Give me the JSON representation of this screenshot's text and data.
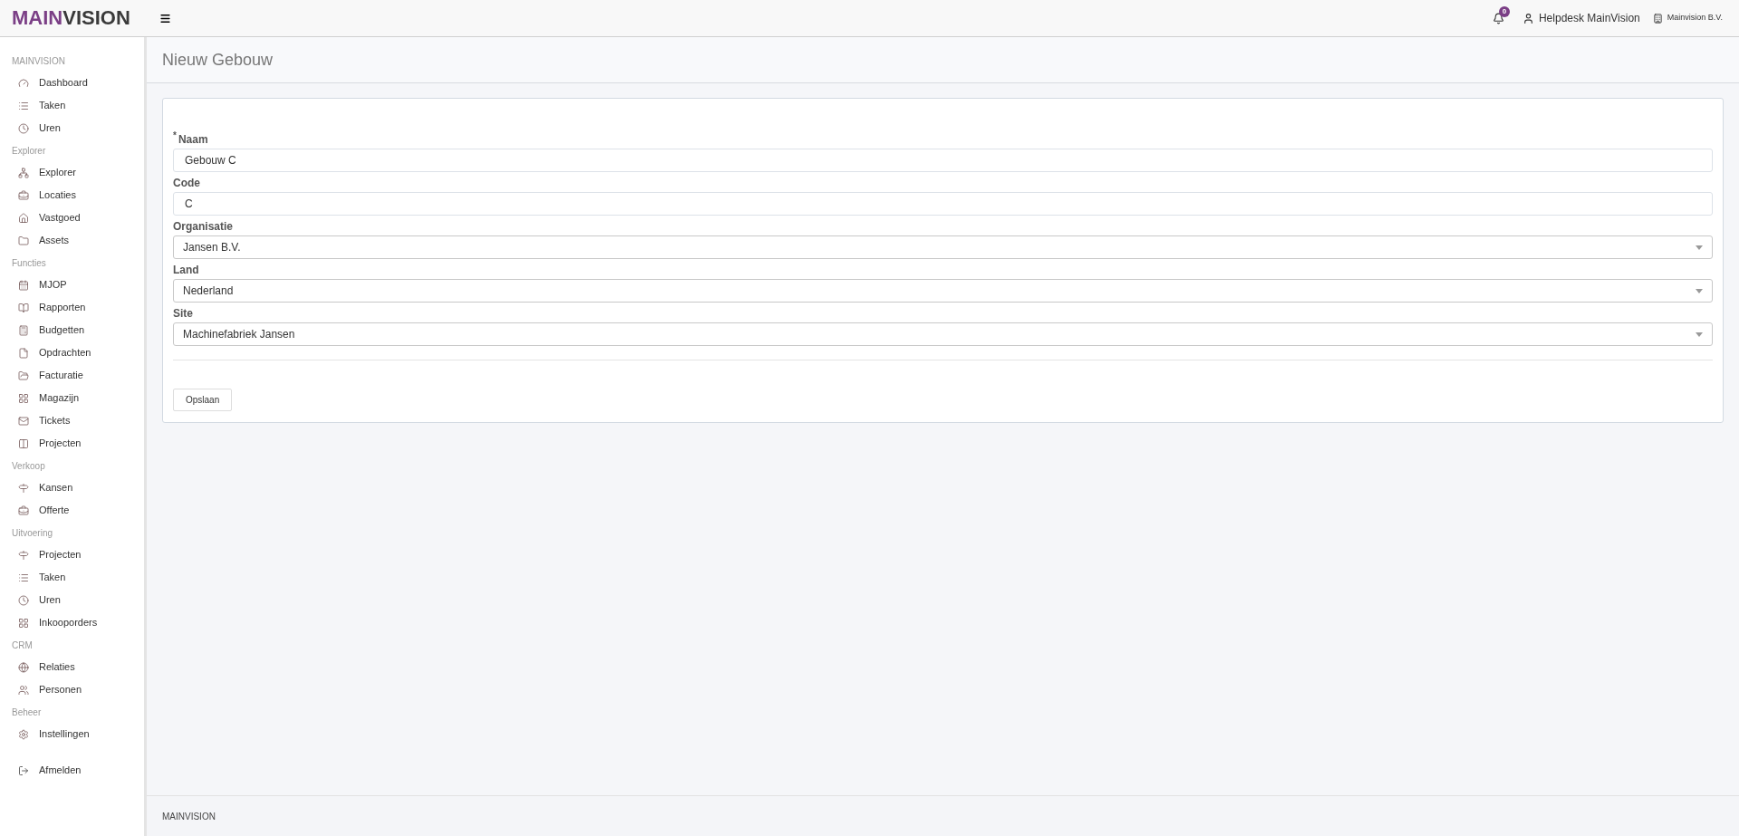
{
  "logo": {
    "parts": [
      "MAIN",
      "VISION"
    ]
  },
  "header": {
    "notifications": "0",
    "user": "Helpdesk MainVision",
    "company": "Mainvision B.V."
  },
  "sidebar": {
    "sections": [
      {
        "title": "MAINVISION",
        "items": [
          "Dashboard",
          "Taken",
          "Uren"
        ]
      },
      {
        "title": "Explorer",
        "items": [
          "Explorer",
          "Locaties",
          "Vastgoed",
          "Assets"
        ]
      },
      {
        "title": "Functies",
        "items": [
          "MJOP",
          "Rapporten",
          "Budgetten",
          "Opdrachten",
          "Facturatie",
          "Magazijn",
          "Tickets",
          "Projecten"
        ]
      },
      {
        "title": "Verkoop",
        "items": [
          "Kansen",
          "Offerte"
        ]
      },
      {
        "title": "Uitvoering",
        "items": [
          "Projecten",
          "Taken",
          "Uren",
          "Inkooporders"
        ]
      },
      {
        "title": "CRM",
        "items": [
          "Relaties",
          "Personen"
        ]
      },
      {
        "title": "Beheer",
        "items": [
          "Instellingen"
        ]
      }
    ],
    "logout": "Afmelden"
  },
  "page": {
    "title": "Nieuw Gebouw"
  },
  "form": {
    "fields": [
      {
        "label": "Naam",
        "required_mark": "*",
        "kind": "text",
        "value": "Gebouw C"
      },
      {
        "label": "Code",
        "kind": "text",
        "value": "C"
      },
      {
        "label": "Organisatie",
        "kind": "select",
        "value": "Jansen B.V."
      },
      {
        "label": "Land",
        "kind": "select",
        "value": "Nederland"
      },
      {
        "label": "Site",
        "kind": "select",
        "value": "Machinefabriek Jansen"
      }
    ],
    "submit": "Opslaan"
  },
  "footer": "MAINVISION"
}
